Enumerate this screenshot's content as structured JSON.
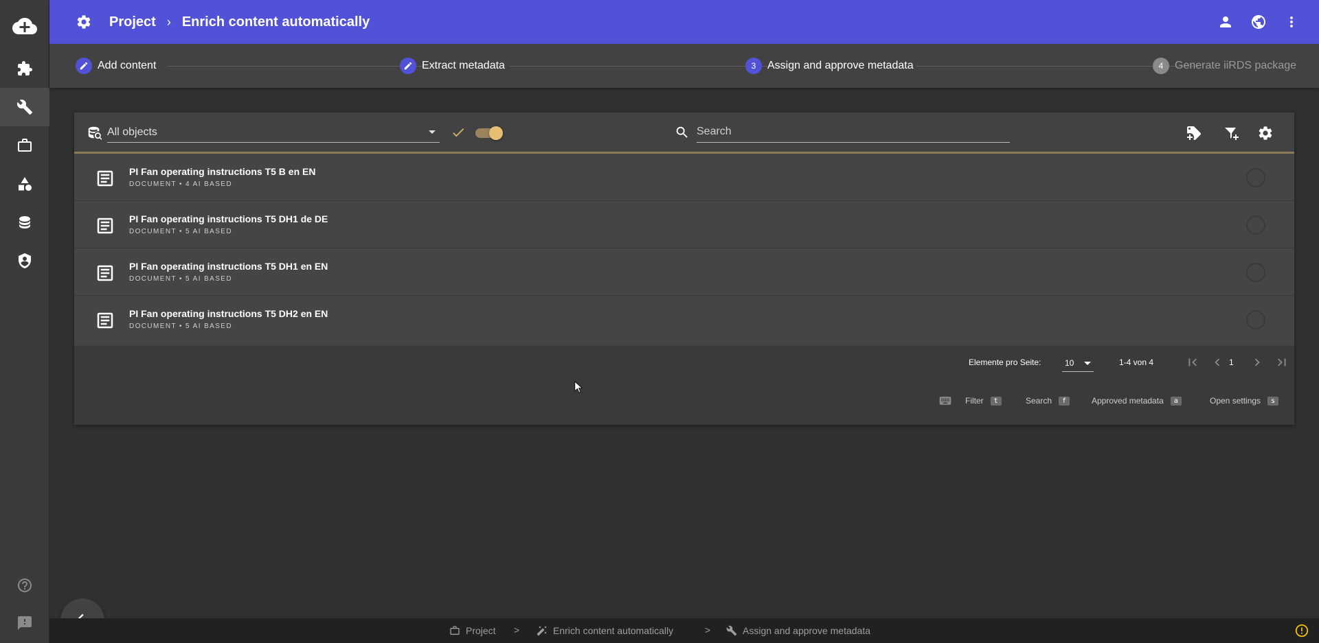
{
  "header": {
    "breadcrumb_root": "Project",
    "breadcrumb_separator": "›",
    "breadcrumb_current": "Enrich content automatically"
  },
  "stepper": {
    "steps": [
      {
        "label": "Add content",
        "state": "done"
      },
      {
        "label": "Extract metadata",
        "state": "done"
      },
      {
        "label": "Assign and approve metadata",
        "number": "3",
        "state": "active"
      },
      {
        "label": "Generate iiRDS package",
        "number": "4",
        "state": "pending"
      }
    ]
  },
  "toolbar": {
    "filter_select_value": "All objects",
    "search_placeholder": "Search",
    "toggle_on": true
  },
  "documents": [
    {
      "title": "PI Fan operating instructions T5 B en EN",
      "subtitle": "DOCUMENT • 4 AI BASED"
    },
    {
      "title": "PI Fan operating instructions T5 DH1 de DE",
      "subtitle": "DOCUMENT • 5 AI BASED"
    },
    {
      "title": "PI Fan operating instructions T5 DH1 en EN",
      "subtitle": "DOCUMENT • 5 AI BASED"
    },
    {
      "title": "PI Fan operating instructions T5 DH2 en EN",
      "subtitle": "DOCUMENT • 5 AI BASED"
    }
  ],
  "paginator": {
    "items_per_page_label": "Elemente pro Seite:",
    "items_per_page_value": "10",
    "range_label": "1-4 von 4",
    "current_page": "1"
  },
  "shortcuts": [
    {
      "label": "Filter",
      "key": "t"
    },
    {
      "label": "Search",
      "key": "f"
    },
    {
      "label": "Approved metadata",
      "key": "a"
    },
    {
      "label": "Open settings",
      "key": "s"
    }
  ],
  "bottombar": {
    "items": [
      "Project",
      "Enrich content automatically",
      "Assign and approve metadata"
    ],
    "separator": ">"
  },
  "colors": {
    "header": "#5252d8",
    "accent": "#e6bf73",
    "warning": "#f2c200"
  }
}
